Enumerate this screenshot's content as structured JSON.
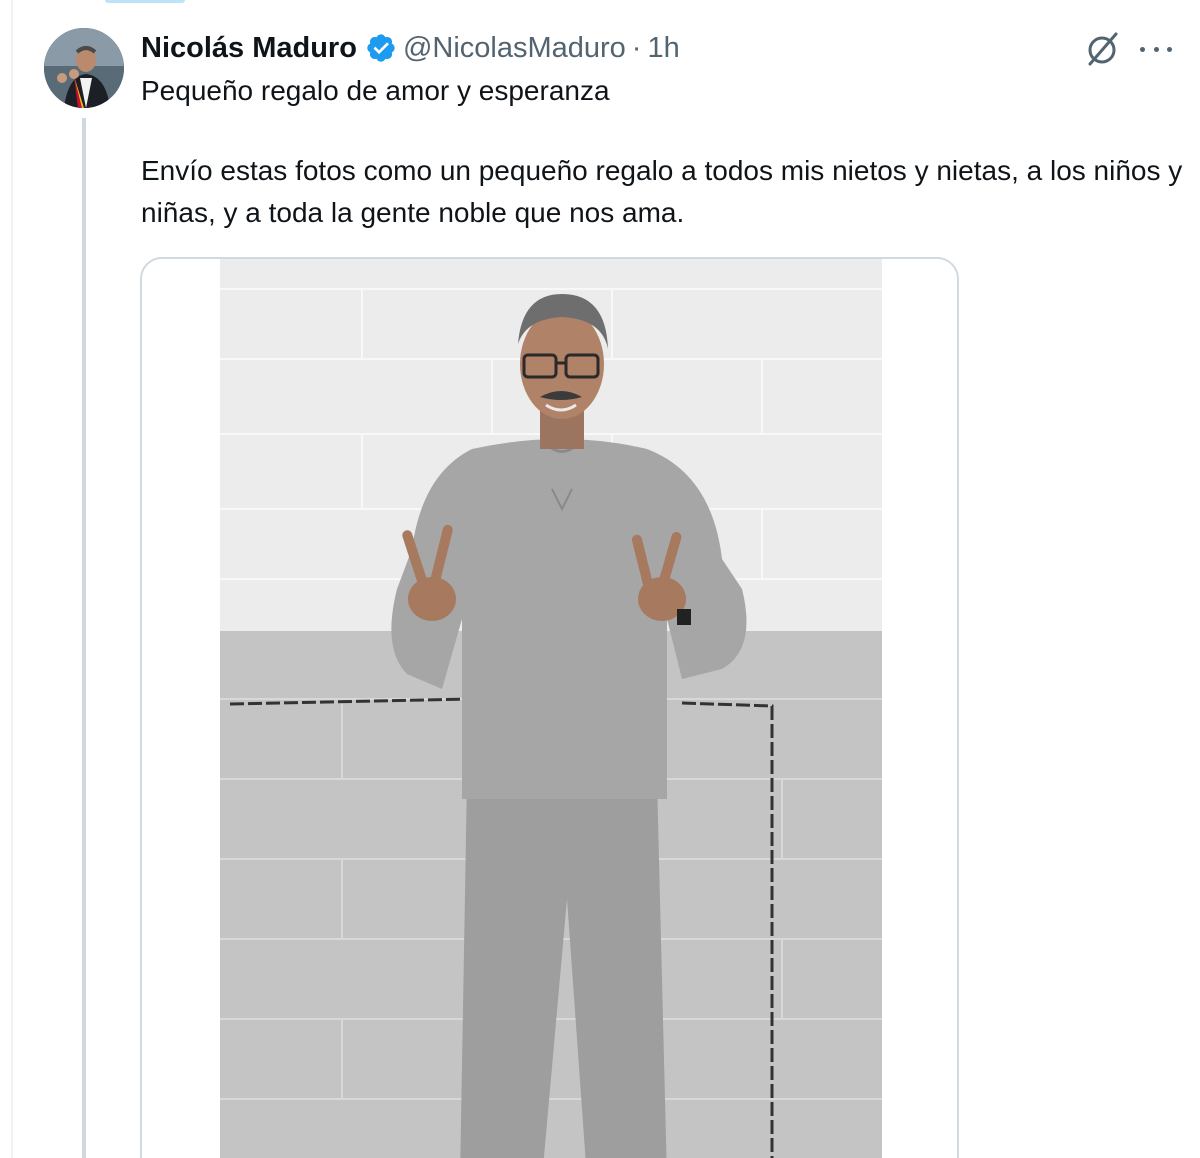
{
  "post": {
    "author_name": "Nicolás Maduro",
    "handle": "@NicolasMaduro",
    "separator": "·",
    "time": "1h",
    "line1": "Pequeño regalo de amor y esperanza",
    "line2": "Envío estas fotos como un pequeño regalo a todos mis nietos y nietas, a los niños y niñas, y a toda la gente noble que nos ama."
  },
  "icons": {
    "verified": "verified-badge-icon",
    "grok": "grok-icon",
    "more": "more-options-icon"
  },
  "colors": {
    "text_primary": "#0f1419",
    "text_secondary": "#536471",
    "verified_blue": "#1d9bf0",
    "border": "#cfd9de"
  }
}
